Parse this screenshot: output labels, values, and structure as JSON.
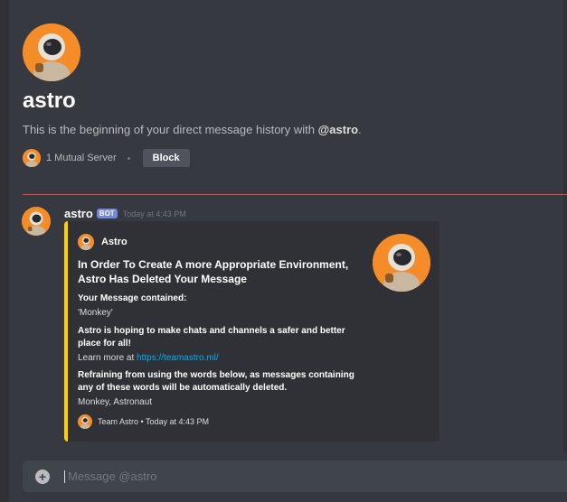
{
  "dm": {
    "title": "astro",
    "intro_prefix": "This is the beginning of your direct message history with ",
    "intro_user": "@astro",
    "intro_suffix": ".",
    "mutual_servers": "1 Mutual Server",
    "block_label": "Block"
  },
  "message": {
    "author": "astro",
    "bot_tag": "BOT",
    "timestamp": "Today at 4:43 PM",
    "embed": {
      "color": "#ffd000",
      "author_name": "Astro",
      "title": "In Order To Create A more Appropriate Environment, Astro Has Deleted Your Message",
      "fields": [
        {
          "name": "Your Message contained:",
          "value": "'Monkey'"
        },
        {
          "name": "Astro is hoping to make chats and channels a safer and better place for all!",
          "value_prefix": "Learn more at ",
          "value_link": "https://teamastro.ml/"
        },
        {
          "name": "Refraining from using the words below, as messages containing any of these words will be automatically deleted.",
          "value": "Monkey, Astronaut"
        }
      ],
      "footer": "Team Astro • Today at 4:43 PM"
    }
  },
  "composer": {
    "placeholder": "Message @astro"
  },
  "colors": {
    "accent_orange": "#f48c2a",
    "bot_tag": "#7289da",
    "new_divider": "#f04747",
    "link": "#00b0f4"
  }
}
